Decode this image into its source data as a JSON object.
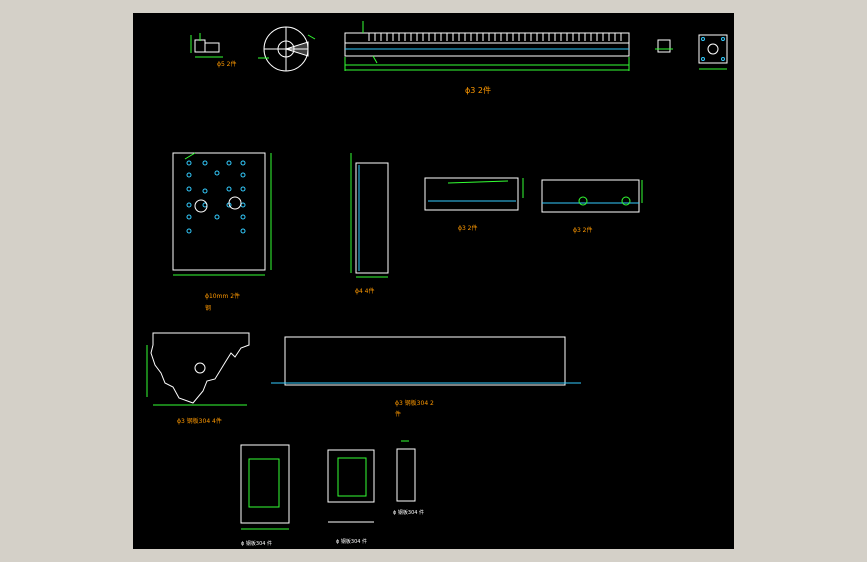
{
  "colors": {
    "frame_bg": "#d4d0c8",
    "canvas_bg": "#000000",
    "outline": "#ffffff",
    "dimension": "#33ff33",
    "label": "#ff9900",
    "center_line": "#33ccff",
    "hole": "#33ccff"
  },
  "labels": {
    "top_small_part": "ϕ5 2件",
    "top_rack": "ϕ3 2件",
    "plate_main": "ϕ10mm 2件",
    "plate_main_2": "钢",
    "bar_vertical": "ϕ4 4件",
    "bar_horizontal_1": "ϕ3 2件",
    "bar_horizontal_2": "ϕ3 2件",
    "tri_plate": "ϕ3 钢板304 4件",
    "long_plate": "ϕ3 钢板304 2",
    "long_plate_2": "件",
    "small_frame_1": "ϕ 钢板304 件",
    "small_frame_2": "ϕ 钢板304 件",
    "small_bar": "ϕ 钢板304 件"
  },
  "icons": {
    "disc": "gear-disc-icon",
    "hole": "bolt-hole-icon"
  }
}
